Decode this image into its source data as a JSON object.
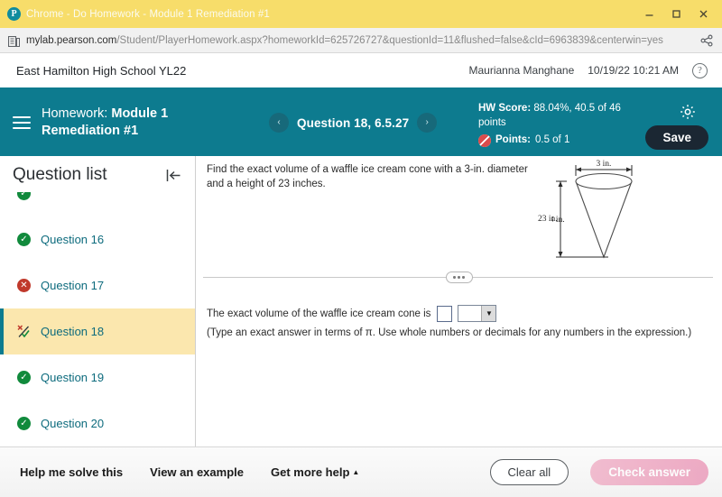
{
  "window": {
    "title": "Chrome - Do Homework - Module 1 Remediation #1",
    "logo_letter": "P",
    "minimize_icon": "minimize-icon",
    "maximize_icon": "maximize-icon",
    "close_icon": "close-icon"
  },
  "browser": {
    "url_host": "mylab.pearson.com",
    "url_path": "/Student/PlayerHomework.aspx?homeworkId=625726727&questionId=11&flushed=false&cId=6963839&centerwin=yes",
    "site_icon": "page-icon",
    "share_icon": "share-icon"
  },
  "schoolbar": {
    "school": "East Hamilton High School YL22",
    "user": "Maurianna Manghane",
    "datetime": "10/19/22 10:21 AM",
    "help_icon": "help-icon",
    "help_label": "?"
  },
  "header": {
    "menu_icon": "hamburger-menu-icon",
    "homework_label": "Homework:",
    "homework_name": "Module 1 Remediation #1",
    "prev_label": "‹",
    "next_label": "›",
    "question_label": "Question 18, 6.5.27",
    "hw_score_label": "HW Score:",
    "hw_score_value": "88.04%, 40.5 of 46 points",
    "points_label": "Points:",
    "points_value": "0.5 of 1",
    "gear_icon": "gear-icon",
    "save_label": "Save",
    "accent_color": "#0d7b8f",
    "save_bg": "#1b2733"
  },
  "sidebar": {
    "title": "Question list",
    "collapse_icon": "collapse-panel-icon",
    "items": [
      {
        "label": "Question 16",
        "status": "correct"
      },
      {
        "label": "Question 17",
        "status": "incorrect"
      },
      {
        "label": "Question 18",
        "status": "partial",
        "active": true
      },
      {
        "label": "Question 19",
        "status": "correct"
      },
      {
        "label": "Question 20",
        "status": "correct"
      }
    ],
    "highlight_color": "#fbe7ae"
  },
  "question": {
    "prompt": "Find the exact volume of a waffle ice cream cone with a 3-in. diameter and a height of 23 inches.",
    "figure": {
      "name": "cone-diagram",
      "width_label": "3 in.",
      "height_label": "23 in."
    },
    "answer_prompt": "The exact volume of the waffle ice cream cone is",
    "answer_value": "",
    "unit_value": "",
    "unit_arrow": "▼",
    "hint": "(Type an exact answer in terms of π. Use whole numbers or decimals for any numbers in the expression.)",
    "drag_handle": "resize-handle"
  },
  "footer": {
    "help_solve": "Help me solve this",
    "view_example": "View an example",
    "get_more_help": "Get more help",
    "get_more_help_caret": "▲",
    "clear_all": "Clear all",
    "check_answer": "Check answer",
    "check_color": "#e98cb0"
  }
}
